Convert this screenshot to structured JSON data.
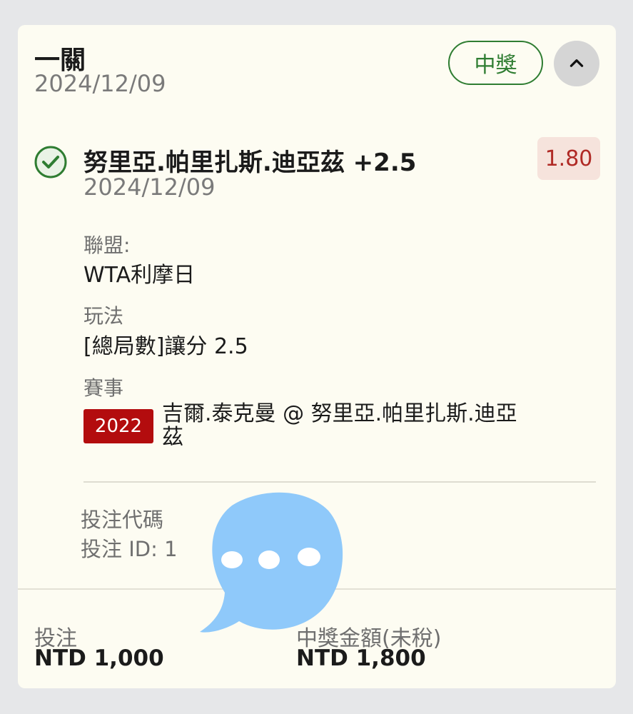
{
  "bet": {
    "title": "一關",
    "date": "2024/12/09",
    "status": "中獎",
    "collapse_icon": "chevron-up-icon"
  },
  "selection": {
    "name": "努里亞.帕里扎斯.迪亞茲 +2.5",
    "date": "2024/12/09",
    "odds": "1.80",
    "status_icon": "check-circle-icon",
    "league_label": "聯盟:",
    "league_value": "WTA利摩日",
    "play_label": "玩法",
    "play_value": "[總局數]讓分 2.5",
    "match_label": "賽事",
    "match_badge": "2022",
    "match_value": "吉爾.泰克曼 @ 努里亞.帕里扎斯.迪亞茲"
  },
  "codes": {
    "bet_code_label": "投注代碼",
    "bet_id_label": "投注 ID: 1"
  },
  "footer": {
    "stake_label": "投注",
    "stake_value": "NTD 1,000",
    "payout_label": "中獎金額(未稅)",
    "payout_value": "NTD 1,800"
  },
  "colors": {
    "win_green": "#2f7d32",
    "odds_red": "#b02a25",
    "badge_red": "#b30c0e",
    "overlay_blue": "#8fc9fa"
  },
  "overlay_icon": "speech-bubble-icon"
}
